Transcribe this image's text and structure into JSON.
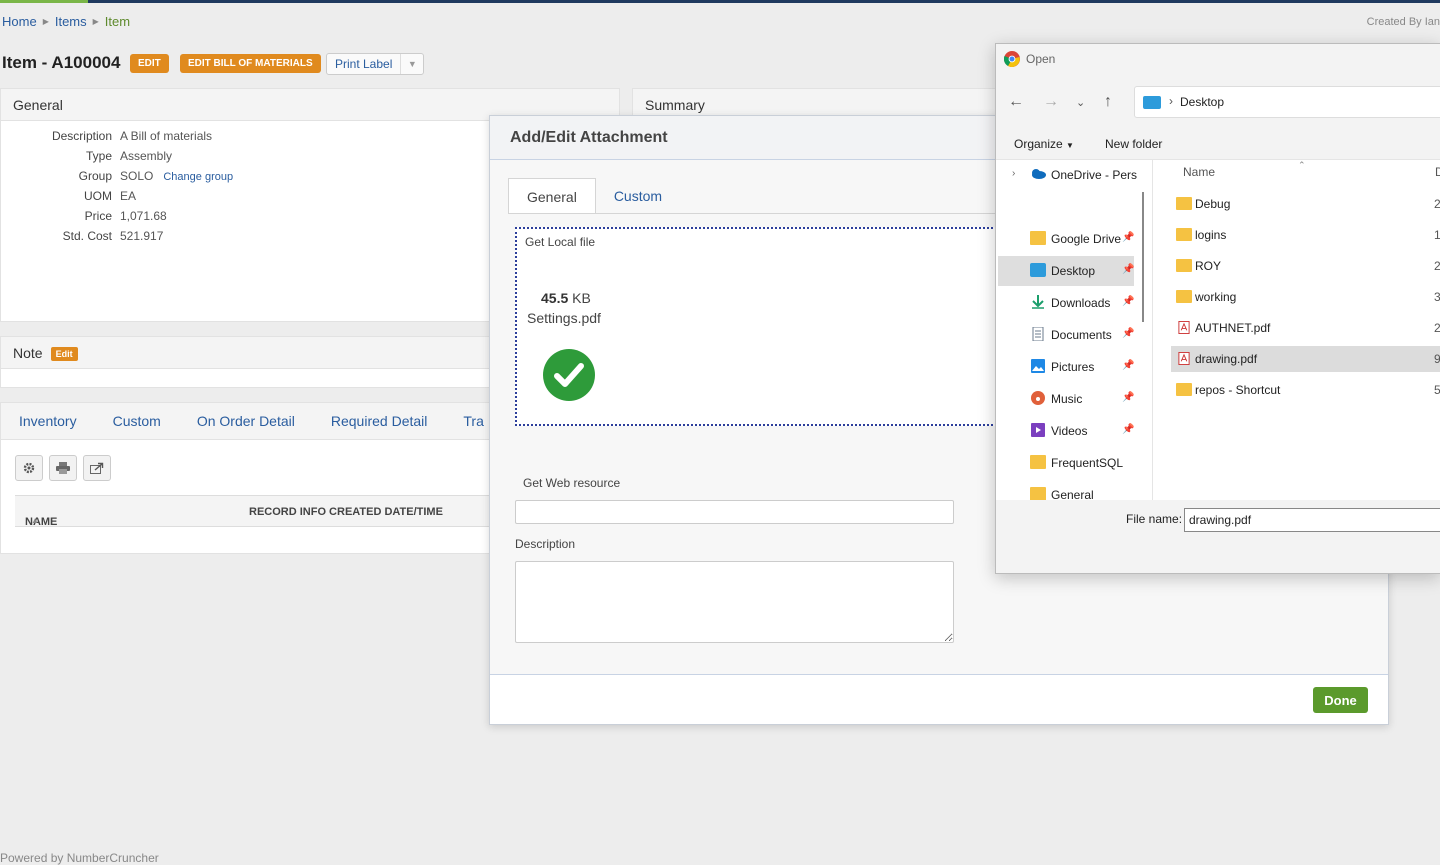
{
  "breadcrumb": {
    "home": "Home",
    "items": "Items",
    "current": "Item"
  },
  "created_by": "Created By Ian",
  "page": {
    "title": "Item - A100004",
    "edit_label": "EDIT",
    "edit_bom_label": "EDIT BILL OF MATERIALS",
    "print_label": "Print Label"
  },
  "general": {
    "heading": "General",
    "fields": [
      {
        "label": "Description",
        "value": "A Bill of materials"
      },
      {
        "label": "Type",
        "value": "Assembly"
      },
      {
        "label": "Group",
        "value": "SOLO",
        "link": "Change group"
      },
      {
        "label": "UOM",
        "value": "EA"
      },
      {
        "label": "Price",
        "value": "1,071.68"
      },
      {
        "label": "Std. Cost",
        "value": "521.917"
      }
    ]
  },
  "summary": {
    "heading": "Summary"
  },
  "note": {
    "heading": "Note",
    "edit_label": "Edit"
  },
  "detail_tabs": [
    "Inventory",
    "Custom",
    "On Order Detail",
    "Required Detail",
    "Tra"
  ],
  "grid": {
    "col_name": "NAME",
    "col_created": "RECORD INFO CREATED DATE/TIME"
  },
  "footer": {
    "powered": "Powered by NumberCruncher"
  },
  "modal": {
    "title": "Add/Edit Attachment",
    "tabs": [
      "General",
      "Custom"
    ],
    "local_file_label": "Get Local file",
    "file_size_value": "45.5",
    "file_size_unit": "KB",
    "file_name": "Settings.pdf",
    "web_resource_label": "Get Web resource",
    "description_label": "Description",
    "done_label": "Done"
  },
  "open_dialog": {
    "title": "Open",
    "address": "Desktop",
    "organize_label": "Organize",
    "new_folder_label": "New folder",
    "nav_items": [
      {
        "label": "OneDrive - Pers",
        "icon": "onedrive-icon"
      },
      {
        "label": "Google Drive",
        "icon": "folder-icon"
      },
      {
        "label": "Desktop",
        "icon": "desktop-icon"
      },
      {
        "label": "Downloads",
        "icon": "download-icon"
      },
      {
        "label": "Documents",
        "icon": "documents-icon"
      },
      {
        "label": "Pictures",
        "icon": "pictures-icon"
      },
      {
        "label": "Music",
        "icon": "music-icon"
      },
      {
        "label": "Videos",
        "icon": "videos-icon"
      },
      {
        "label": "FrequentSQL",
        "icon": "folder-icon"
      },
      {
        "label": "General",
        "icon": "folder-icon"
      }
    ],
    "col_name": "Name",
    "col_date": "D",
    "files": [
      {
        "name": "Debug",
        "type": "folder",
        "meta": "2,"
      },
      {
        "name": "logins",
        "type": "folder",
        "meta": "1,"
      },
      {
        "name": "ROY",
        "type": "folder",
        "meta": "2,"
      },
      {
        "name": "working",
        "type": "folder",
        "meta": "3,"
      },
      {
        "name": "AUTHNET.pdf",
        "type": "pdf",
        "meta": "2,"
      },
      {
        "name": "drawing.pdf",
        "type": "pdf",
        "meta": "9,"
      },
      {
        "name": "repos - Shortcut",
        "type": "shortcut",
        "meta": "5,"
      }
    ],
    "file_name_label": "File name:",
    "file_name_value": "drawing.pdf"
  },
  "colors": {
    "accent_orange": "#e08a1e",
    "link_blue": "#2a5d9f",
    "done_green": "#5b9a2c",
    "check_green": "#2e9b3a",
    "focus_border": "#2c3e9b"
  }
}
